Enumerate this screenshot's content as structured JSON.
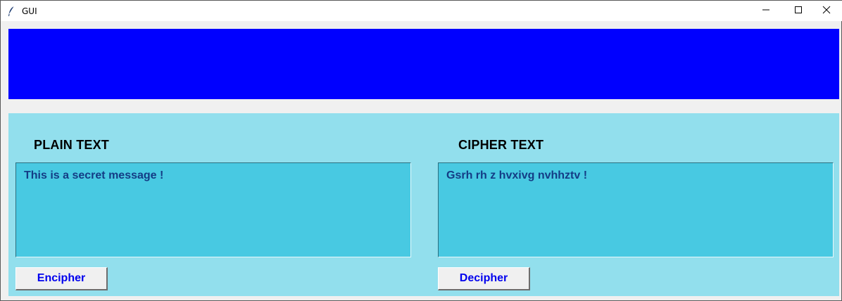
{
  "window": {
    "title": "GUI"
  },
  "colors": {
    "banner": "#0000ff",
    "panel": "#92dfed",
    "textbox": "#48c9e2",
    "textbox_text": "#143c85",
    "button_text": "#0000ee"
  },
  "plain": {
    "label": "PLAIN TEXT",
    "value": "This is a secret message !",
    "button_label": "Encipher"
  },
  "cipher": {
    "label": "CIPHER TEXT",
    "value": "Gsrh rh z hvxivg nvhhztv !",
    "button_label": "Decipher"
  },
  "icons": {
    "app": "feather-icon",
    "minimize": "minimize-icon",
    "maximize": "maximize-icon",
    "close": "close-icon"
  }
}
